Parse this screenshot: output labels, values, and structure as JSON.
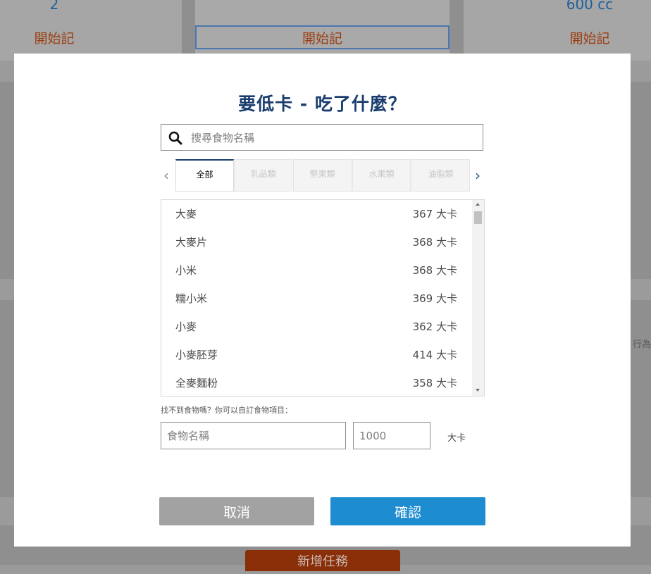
{
  "background": {
    "cards": [
      {
        "value": "2",
        "start_label": "開始記"
      },
      {
        "value": "",
        "start_label": "開始記"
      },
      {
        "value": "600 cc",
        "start_label": "開始記"
      }
    ],
    "add_task_label": "新增任務",
    "edge_text": "行為"
  },
  "modal": {
    "title": "要低卡 - 吃了什麼？",
    "search": {
      "placeholder": "搜尋食物名稱",
      "value": ""
    },
    "tabs": [
      {
        "label": "全部",
        "active": true
      },
      {
        "label": "乳品類",
        "active": false
      },
      {
        "label": "堅果類",
        "active": false
      },
      {
        "label": "水果類",
        "active": false
      },
      {
        "label": "油脂類",
        "active": false
      }
    ],
    "foods": [
      {
        "name": "大麥",
        "calories": "367 大卡"
      },
      {
        "name": "大麥片",
        "calories": "368 大卡"
      },
      {
        "name": "小米",
        "calories": "368 大卡"
      },
      {
        "name": "糯小米",
        "calories": "369 大卡"
      },
      {
        "name": "小麥",
        "calories": "362 大卡"
      },
      {
        "name": "小麥胚芽",
        "calories": "414 大卡"
      },
      {
        "name": "全麥麵粉",
        "calories": "358 大卡"
      }
    ],
    "custom_hint": "找不到食物嗎？你可以自訂食物項目：",
    "custom_name_placeholder": "食物名稱",
    "custom_calories_placeholder": "1000",
    "unit_label": "大卡",
    "cancel_label": "取消",
    "confirm_label": "確認"
  },
  "colors": {
    "title": "#1a3d6e",
    "confirm": "#1e8cd1",
    "cancel": "#a2a2a2",
    "start_label": "#9c3c10"
  }
}
